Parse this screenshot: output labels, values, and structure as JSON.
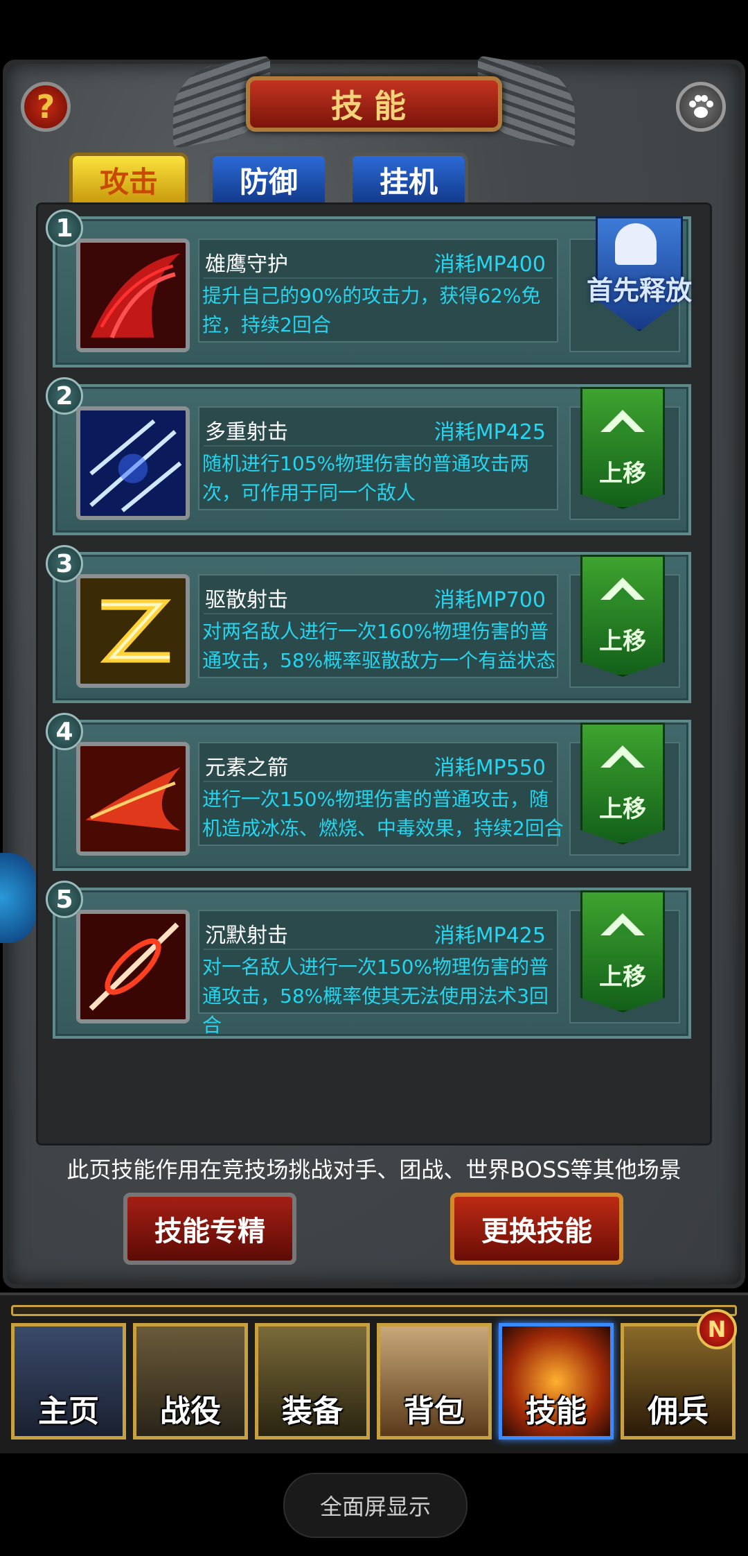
{
  "header": {
    "title": "技能",
    "help_icon": "question-icon",
    "pet_icon": "paw-icon",
    "help_glyph": "?"
  },
  "tabs": [
    {
      "label": "攻击",
      "active": true
    },
    {
      "label": "防御",
      "active": false
    },
    {
      "label": "挂机",
      "active": false
    }
  ],
  "skills": [
    {
      "index": "1",
      "name": "雄鹰守护",
      "cost": "消耗MP400",
      "desc": "提升自己的90%的攻击力，获得62%免控，持续2回合",
      "action": "首先释放",
      "icon": "eagle-wing-icon"
    },
    {
      "index": "2",
      "name": "多重射击",
      "cost": "消耗MP425",
      "desc": "随机进行105%物理伤害的普通攻击两次，可作用于同一个敌人",
      "action": "上移",
      "icon": "multi-arrow-icon"
    },
    {
      "index": "3",
      "name": "驱散射击",
      "cost": "消耗MP700",
      "desc": "对两名敌人进行一次160%物理伤害的普通攻击，58%概率驱散敌方一个有益状态",
      "action": "上移",
      "icon": "lightning-chain-icon"
    },
    {
      "index": "4",
      "name": "元素之箭",
      "cost": "消耗MP550",
      "desc": "进行一次150%物理伤害的普通攻击，随机造成冰冻、燃烧、中毒效果，持续2回合",
      "action": "上移",
      "icon": "flame-feather-icon"
    },
    {
      "index": "5",
      "name": "沉默射击",
      "cost": "消耗MP425",
      "desc": "对一名敌人进行一次150%物理伤害的普通攻击，58%概率使其无法使用法术3回合",
      "action": "上移",
      "icon": "silence-spear-icon"
    }
  ],
  "note": "此页技能作用在竞技场挑战对手、团战、世界BOSS等其他场景",
  "buttons": {
    "mastery": "技能专精",
    "change": "更换技能"
  },
  "nav": [
    {
      "label": "主页",
      "active": false
    },
    {
      "label": "战役",
      "active": false
    },
    {
      "label": "装备",
      "active": false
    },
    {
      "label": "背包",
      "active": false
    },
    {
      "label": "技能",
      "active": true
    },
    {
      "label": "佣兵",
      "active": false
    }
  ],
  "new_badge": "N",
  "system_button": "全面屏显示",
  "colors": {
    "accent_cyan": "#26d4ee",
    "up_green": "#3ea32f",
    "first_blue": "#3d7bd8",
    "tab_gold": "#fbe23c"
  }
}
